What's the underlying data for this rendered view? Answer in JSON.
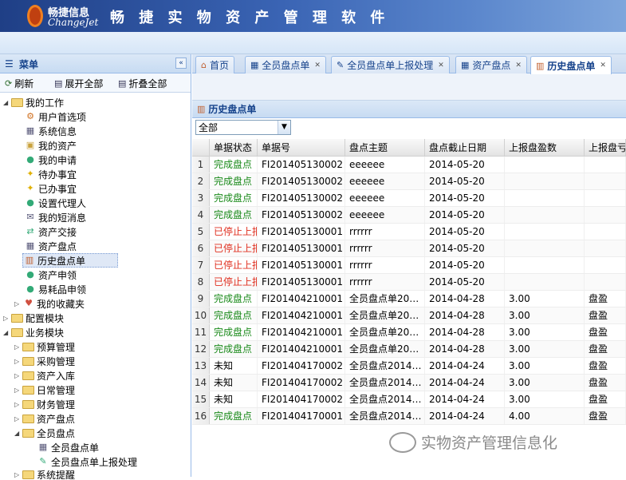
{
  "header": {
    "logo_cn": "畅捷信息",
    "logo_en": "ChangeJet",
    "app_title": "畅 捷 实 物 资 产 管 理 软 件"
  },
  "sidebar": {
    "title": "菜单",
    "tools": {
      "refresh": "刷新",
      "expand_all": "展开全部",
      "collapse_all": "折叠全部"
    },
    "tree": {
      "my_work": "我的工作",
      "items": [
        "用户首选项",
        "系统信息",
        "我的资产",
        "我的申请",
        "待办事宜",
        "已办事宜",
        "设置代理人",
        "我的短消息",
        "资产交接",
        "资产盘点",
        "历史盘点单",
        "资产申领",
        "易耗品申领",
        "我的收藏夹"
      ],
      "config": "配置模块",
      "business": "业务模块",
      "business_items": [
        "预算管理",
        "采购管理",
        "资产入库",
        "日常管理",
        "财务管理",
        "资产盘点",
        "全员盘点"
      ],
      "full_items": [
        "全员盘点单",
        "全员盘点单上报处理"
      ],
      "more": "系统提醒"
    }
  },
  "tabs": [
    "首页",
    "全员盘点单",
    "全员盘点单上报处理",
    "资产盘点",
    "历史盘点单"
  ],
  "panel": {
    "title": "历史盘点单",
    "filter_value": "全部"
  },
  "grid": {
    "columns": [
      "单据状态",
      "单据号",
      "盘点主题",
      "盘点截止日期",
      "上报盘盈数",
      "上报盘亏"
    ],
    "rows": [
      {
        "n": "1",
        "status": "完成盘点",
        "kind": "done",
        "no": "FI201405130002",
        "topic": "eeeeee",
        "date": "2014-05-20",
        "count": "",
        "type": ""
      },
      {
        "n": "2",
        "status": "完成盘点",
        "kind": "done",
        "no": "FI201405130002",
        "topic": "eeeeee",
        "date": "2014-05-20",
        "count": "",
        "type": ""
      },
      {
        "n": "3",
        "status": "完成盘点",
        "kind": "done",
        "no": "FI201405130002",
        "topic": "eeeeee",
        "date": "2014-05-20",
        "count": "",
        "type": ""
      },
      {
        "n": "4",
        "status": "完成盘点",
        "kind": "done",
        "no": "FI201405130002",
        "topic": "eeeeee",
        "date": "2014-05-20",
        "count": "",
        "type": ""
      },
      {
        "n": "5",
        "status": "已停止上报",
        "kind": "stop",
        "no": "FI201405130001",
        "topic": "rrrrrr",
        "date": "2014-05-20",
        "count": "",
        "type": ""
      },
      {
        "n": "6",
        "status": "已停止上报",
        "kind": "stop",
        "no": "FI201405130001",
        "topic": "rrrrrr",
        "date": "2014-05-20",
        "count": "",
        "type": ""
      },
      {
        "n": "7",
        "status": "已停止上报",
        "kind": "stop",
        "no": "FI201405130001",
        "topic": "rrrrrr",
        "date": "2014-05-20",
        "count": "",
        "type": ""
      },
      {
        "n": "8",
        "status": "已停止上报",
        "kind": "stop",
        "no": "FI201405130001",
        "topic": "rrrrrr",
        "date": "2014-05-20",
        "count": "",
        "type": ""
      },
      {
        "n": "9",
        "status": "完成盘点",
        "kind": "done",
        "no": "FI201404210001",
        "topic": "全员盘点单20…",
        "date": "2014-04-28",
        "count": "3.00",
        "type": "盘盈"
      },
      {
        "n": "10",
        "status": "完成盘点",
        "kind": "done",
        "no": "FI201404210001",
        "topic": "全员盘点单20…",
        "date": "2014-04-28",
        "count": "3.00",
        "type": "盘盈"
      },
      {
        "n": "11",
        "status": "完成盘点",
        "kind": "done",
        "no": "FI201404210001",
        "topic": "全员盘点单20…",
        "date": "2014-04-28",
        "count": "3.00",
        "type": "盘盈"
      },
      {
        "n": "12",
        "status": "完成盘点",
        "kind": "done",
        "no": "FI201404210001",
        "topic": "全员盘点单20…",
        "date": "2014-04-28",
        "count": "3.00",
        "type": "盘盈"
      },
      {
        "n": "13",
        "status": "未知",
        "kind": "unk",
        "no": "FI201404170002",
        "topic": "全员盘点2014…",
        "date": "2014-04-24",
        "count": "3.00",
        "type": "盘盈"
      },
      {
        "n": "14",
        "status": "未知",
        "kind": "unk",
        "no": "FI201404170002",
        "topic": "全员盘点2014…",
        "date": "2014-04-24",
        "count": "3.00",
        "type": "盘盈"
      },
      {
        "n": "15",
        "status": "未知",
        "kind": "unk",
        "no": "FI201404170002",
        "topic": "全员盘点2014…",
        "date": "2014-04-24",
        "count": "3.00",
        "type": "盘盈"
      },
      {
        "n": "16",
        "status": "完成盘点",
        "kind": "done",
        "no": "FI201404170001",
        "topic": "全员盘点2014…",
        "date": "2014-04-24",
        "count": "4.00",
        "type": "盘盈"
      }
    ]
  },
  "watermark": "实物资产管理信息化"
}
